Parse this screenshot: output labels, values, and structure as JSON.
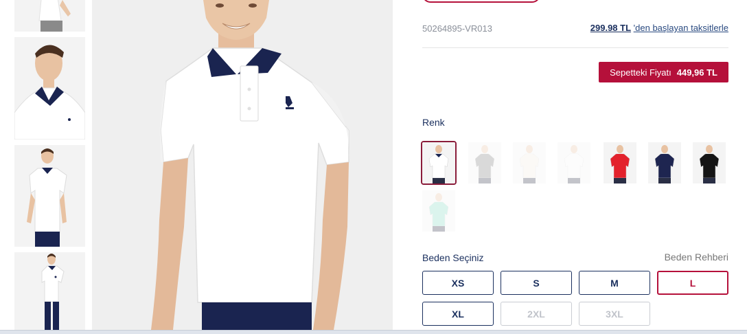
{
  "product": {
    "sku": "50264895-VR013",
    "installment_price": "299.98 TL",
    "installment_text": "'den başlayan taksitlerle",
    "basket_label": "Sepetteki Fiyatı",
    "basket_price": "449,96 TL"
  },
  "color_section": {
    "label": "Renk",
    "swatches": [
      {
        "color": "#ffffff",
        "collar": "#1a2450",
        "selected": true
      },
      {
        "color": "#7a7a7a",
        "collar": "#7a7a7a",
        "selected": false
      },
      {
        "color": "#f2ecdf",
        "collar": "#f2ecdf",
        "selected": false
      },
      {
        "color": "#f7f7f7",
        "collar": "#f7f7f7",
        "selected": false
      },
      {
        "color": "#e3222c",
        "collar": "#e3222c",
        "selected": false
      },
      {
        "color": "#1e2550",
        "collar": "#1e2550",
        "selected": false
      },
      {
        "color": "#151515",
        "collar": "#151515",
        "selected": false
      },
      {
        "color": "#7fd8c2",
        "collar": "#7fd8c2",
        "selected": false
      }
    ]
  },
  "size_section": {
    "label": "Beden Seçiniz",
    "guide": "Beden Rehberi",
    "sizes": [
      {
        "label": "XS",
        "state": "available"
      },
      {
        "label": "S",
        "state": "available"
      },
      {
        "label": "M",
        "state": "available"
      },
      {
        "label": "L",
        "state": "selected"
      },
      {
        "label": "XL",
        "state": "available"
      },
      {
        "label": "2XL",
        "state": "disabled"
      },
      {
        "label": "3XL",
        "state": "disabled"
      }
    ]
  },
  "colors": {
    "accent": "#b5103a",
    "navy": "#1a2f5e"
  }
}
